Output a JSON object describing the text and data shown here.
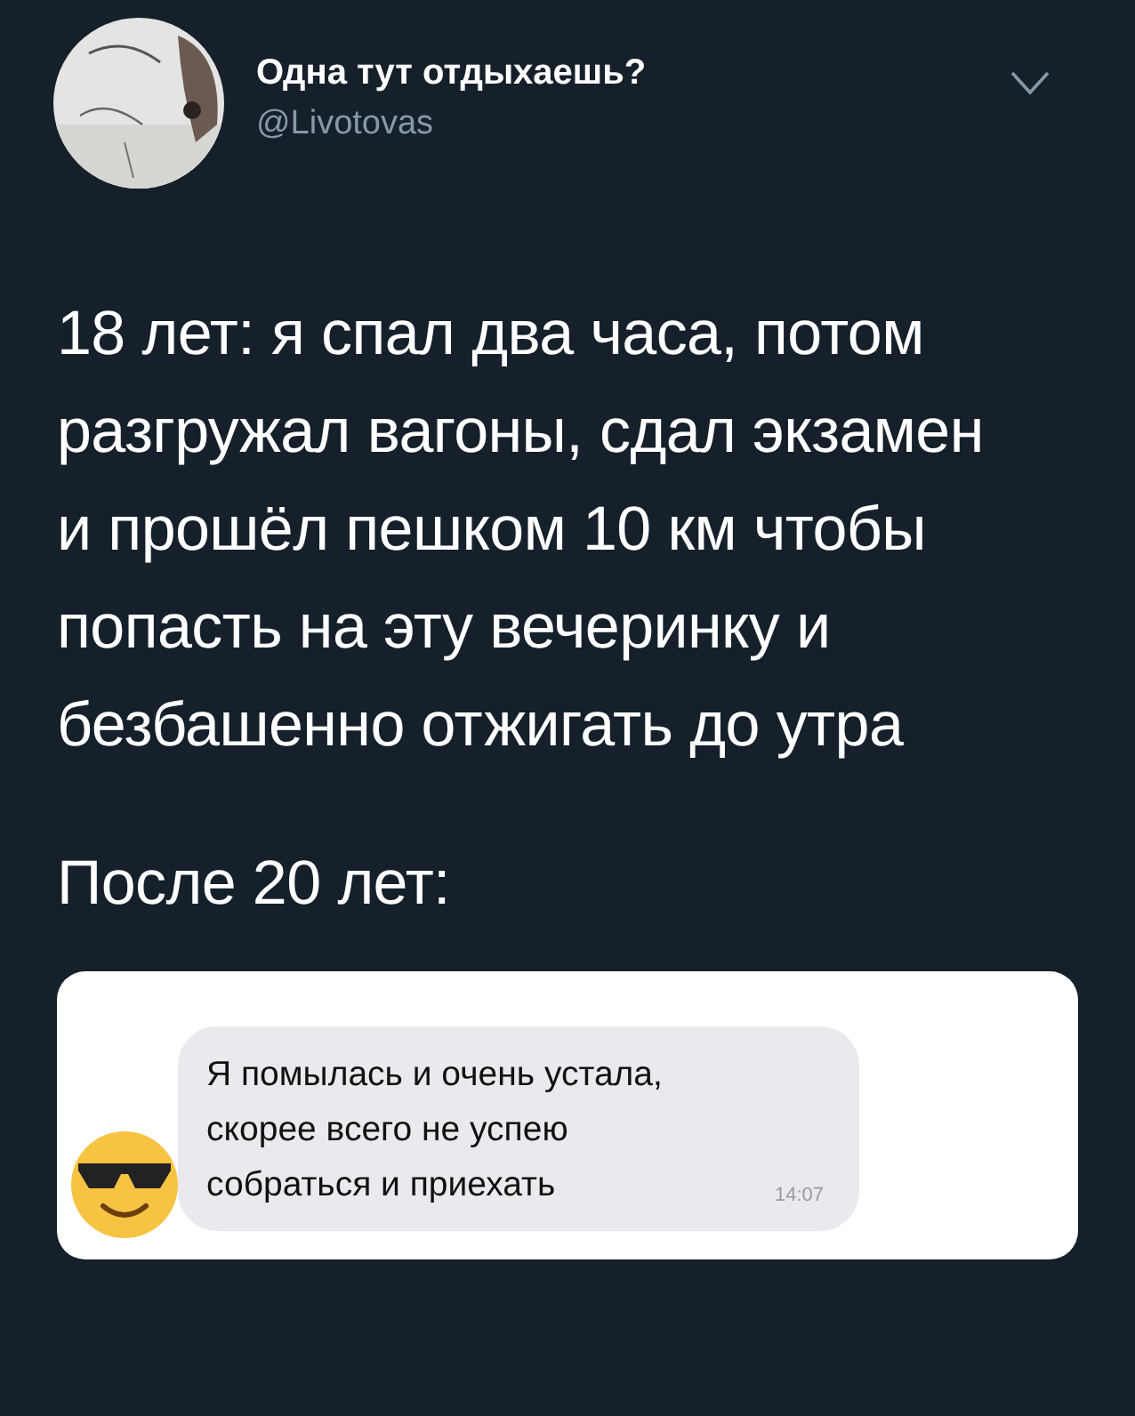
{
  "tweet": {
    "author_name": "Одна тут отдыхаешь?",
    "handle": "@Livotovas",
    "paragraphs": [
      "18 лет: я спал два часа, потом разгружал вагоны, сдал экзамен и прошёл пешком 10 км чтобы попасть на эту вечеринку и безбашенно отжигать до утра",
      "После 20 лет:"
    ],
    "attached_screenshot": {
      "message": {
        "text": "Я помылась и очень устала, скорее всего не успею собраться и приехать",
        "time": "14:07"
      }
    }
  }
}
